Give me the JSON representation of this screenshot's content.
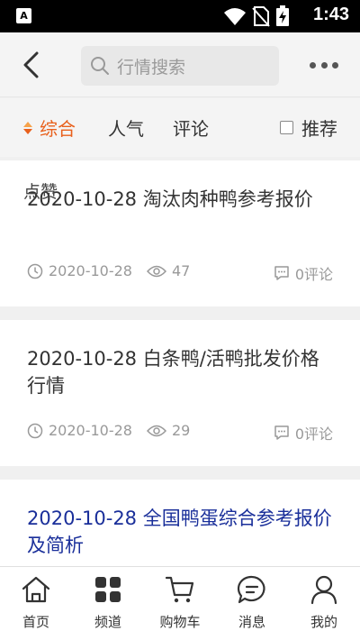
{
  "status_bar": {
    "app_badge": "A",
    "time": "1:43",
    "icons": [
      "wifi-icon",
      "no-sim-icon",
      "battery-charging-icon"
    ]
  },
  "header": {
    "back_icon": "chevron-left-icon",
    "search_placeholder": "行情搜索",
    "more_icon": "more-dots-icon"
  },
  "filters": {
    "sort_label": "综合",
    "popularity_label": "人气",
    "comments_label": "评论",
    "recommend_label": "推荐",
    "active": "综合",
    "accent_color": "#e8601c"
  },
  "overlay_label": "点赞",
  "articles": [
    {
      "title": "2020-10-28 淘汰肉种鸭参考报价",
      "date": "2020-10-28",
      "views": "47",
      "comments": "0评论"
    },
    {
      "title": "2020-10-28 白条鸭/活鸭批发价格行情",
      "date": "2020-10-28",
      "views": "29",
      "comments": "0评论"
    },
    {
      "title": "2020-10-28 全国鸭蛋综合参考报价及简析",
      "title_color": "#1a2f9a"
    }
  ],
  "bottom_nav": [
    {
      "label": "首页",
      "icon": "home-icon"
    },
    {
      "label": "频道",
      "icon": "grid-icon"
    },
    {
      "label": "购物车",
      "icon": "cart-icon"
    },
    {
      "label": "消息",
      "icon": "message-icon"
    },
    {
      "label": "我的",
      "icon": "user-icon"
    }
  ]
}
